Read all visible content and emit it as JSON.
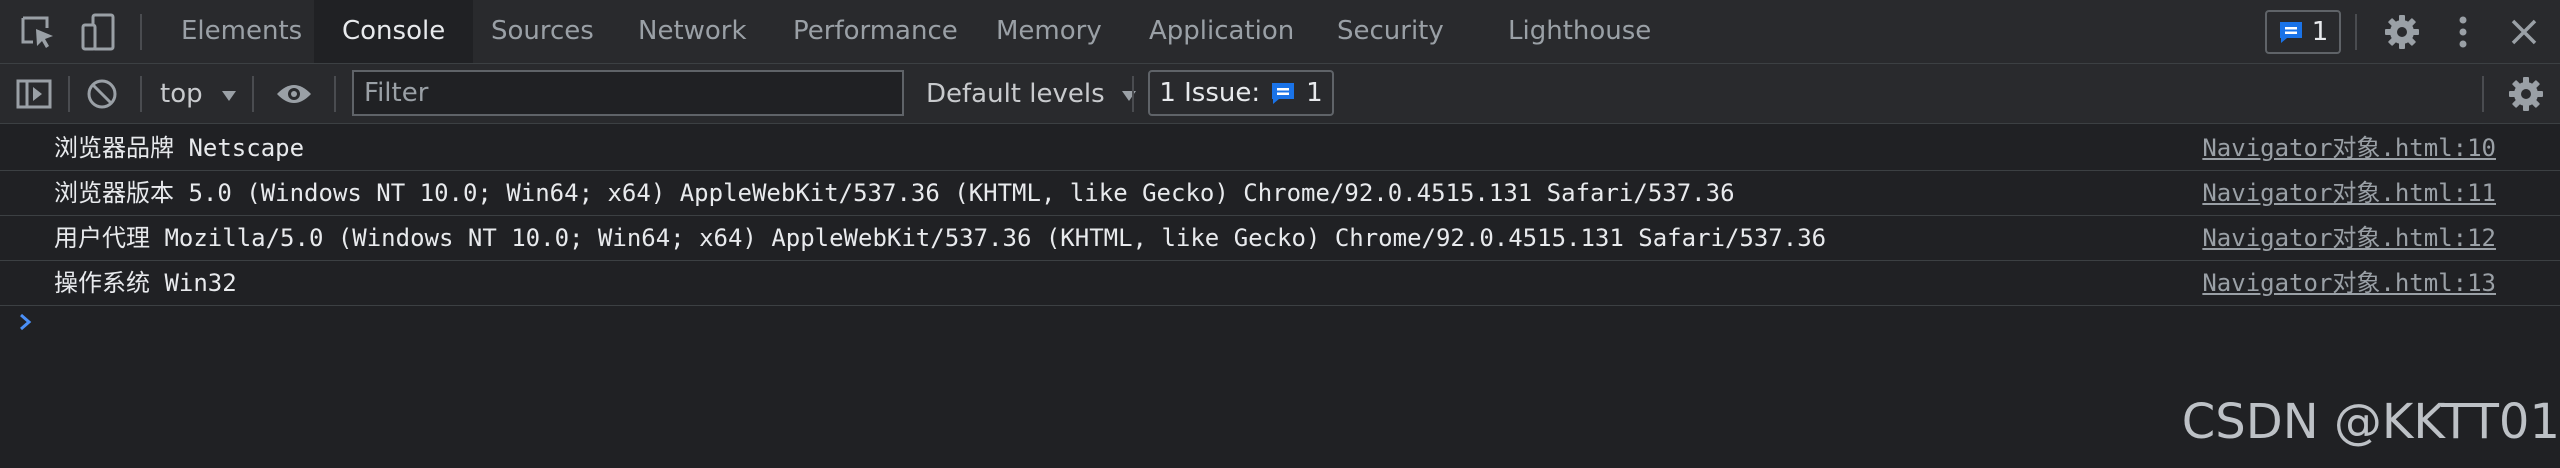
{
  "tabs": [
    {
      "label": "Elements"
    },
    {
      "label": "Console"
    },
    {
      "label": "Sources"
    },
    {
      "label": "Network"
    },
    {
      "label": "Performance"
    },
    {
      "label": "Memory"
    },
    {
      "label": "Application"
    },
    {
      "label": "Security"
    },
    {
      "label": "Lighthouse"
    }
  ],
  "header": {
    "issues_count": "1"
  },
  "toolbar": {
    "context": "top",
    "filter_placeholder": "Filter",
    "filter_value": "",
    "levels_label": "Default levels",
    "issue_label": "1 Issue:",
    "issue_count": "1"
  },
  "logs": [
    {
      "message": "浏览器品牌 Netscape",
      "source": "Navigator对象.html:10"
    },
    {
      "message": "浏览器版本 5.0 (Windows NT 10.0; Win64; x64) AppleWebKit/537.36 (KHTML, like Gecko) Chrome/92.0.4515.131 Safari/537.36",
      "source": "Navigator对象.html:11"
    },
    {
      "message": "用户代理 Mozilla/5.0 (Windows NT 10.0; Win64; x64) AppleWebKit/537.36 (KHTML, like Gecko) Chrome/92.0.4515.131 Safari/537.36",
      "source": "Navigator对象.html:12"
    },
    {
      "message": "操作系统 Win32",
      "source": "Navigator对象.html:13"
    }
  ],
  "watermark": "CSDN @KKTT01",
  "colors": {
    "background": "#202124",
    "toolbar": "#292a2d",
    "accent": "#1a73e8",
    "prompt": "#4a8ff7"
  },
  "icons": [
    "inspect-icon",
    "device-toggle-icon",
    "issues-icon",
    "settings-icon",
    "more-icon",
    "close-icon",
    "sidebar-toggle-icon",
    "clear-console-icon",
    "dropdown-icon",
    "eye-icon",
    "prompt-chevron-icon"
  ]
}
